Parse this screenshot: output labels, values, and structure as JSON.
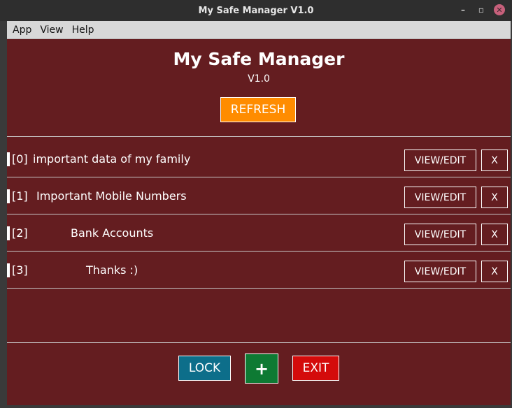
{
  "window": {
    "title": "My Safe Manager V1.0",
    "minimize": "–",
    "restore": "▫",
    "close": "✕"
  },
  "menu": {
    "items": [
      "App",
      "View",
      "Help"
    ]
  },
  "header": {
    "title": "My Safe Manager",
    "version": "V1.0",
    "refresh_label": "REFRESH"
  },
  "entries": [
    {
      "index": "[0]",
      "label": "important data of my family",
      "view_label": "VIEW/EDIT",
      "delete_label": "X"
    },
    {
      "index": "[1]",
      "label": "Important Mobile Numbers",
      "view_label": "VIEW/EDIT",
      "delete_label": "X"
    },
    {
      "index": "[2]",
      "label": "Bank Accounts",
      "view_label": "VIEW/EDIT",
      "delete_label": "X"
    },
    {
      "index": "[3]",
      "label": "Thanks :)",
      "view_label": "VIEW/EDIT",
      "delete_label": "X"
    }
  ],
  "footer": {
    "lock_label": "LOCK",
    "add_label": "+",
    "exit_label": "EXIT"
  },
  "colors": {
    "background": "#641d20",
    "refresh": "#ff8c00",
    "lock": "#0d6e8a",
    "add": "#0e7a33",
    "exit": "#d40b0b"
  }
}
